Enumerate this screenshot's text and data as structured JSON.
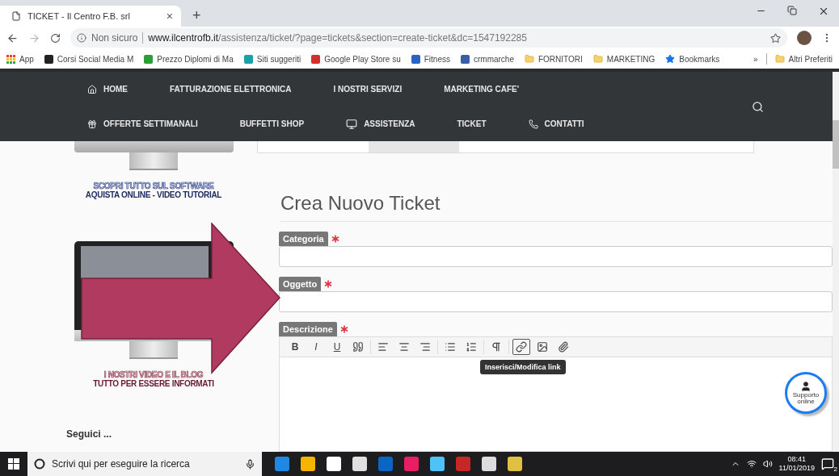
{
  "browser": {
    "tab": {
      "title": "TICKET - Il Centro F.B. srl",
      "close": "×"
    },
    "new_tab": "+",
    "address": {
      "security": "Non sicuro",
      "domain": "www.ilcentrofb.it",
      "path": "/assistenza/ticket/?page=tickets&section=create-ticket&dc=1547192285"
    },
    "bookmarks": [
      {
        "label": "App",
        "kind": "apps"
      },
      {
        "label": "Corsi Social Media M",
        "kind": "favicon",
        "color": "#222222"
      },
      {
        "label": "Prezzo Diplomi di Ma",
        "kind": "favicon",
        "color": "#2e9c3a"
      },
      {
        "label": "Siti suggeriti",
        "kind": "favicon",
        "color": "#1ba0a8"
      },
      {
        "label": "Google Play Store su",
        "kind": "favicon",
        "color": "#d32f2f"
      },
      {
        "label": "Fitness",
        "kind": "favicon",
        "color": "#2b63c5"
      },
      {
        "label": "crmmarche",
        "kind": "favicon",
        "color": "#3b5ea8"
      },
      {
        "label": "FORNITORI",
        "kind": "folder"
      },
      {
        "label": "MARKETING",
        "kind": "folder"
      },
      {
        "label": "Bookmarks",
        "kind": "star"
      }
    ],
    "overflow": "»",
    "other_bookmarks": "Altri Preferiti"
  },
  "nav": {
    "rows": [
      [
        {
          "label": "HOME",
          "kind": "home"
        },
        {
          "label": "FATTURAZIONE ELETTRONICA",
          "kind": "plain"
        },
        {
          "label": "I NOSTRI SERVIZI",
          "kind": "plain"
        },
        {
          "label": "MARKETING CAFE'",
          "kind": "plain"
        }
      ],
      [
        {
          "label": "OFFERTE SETTIMANALI",
          "kind": "gift"
        },
        {
          "label": "BUFFETTI SHOP",
          "kind": "plain"
        },
        {
          "label": "ASSISTENZA",
          "kind": "monitor"
        },
        {
          "label": "TICKET",
          "kind": "plain"
        },
        {
          "label": "CONTATTI",
          "kind": "phone"
        }
      ]
    ]
  },
  "sidebar": {
    "captions": [
      {
        "line1": "SCOPRI TUTTO SUL SOFTWARE",
        "line2": "AQUISTA ONLINE - VIDEO TUTORIAL",
        "kind": "software"
      },
      {
        "line1": "I NOSTRI VIDEO E IL BLOG",
        "line2": "TUTTO PER ESSERE INFORMATI",
        "kind": "blog"
      }
    ],
    "follow": "Seguici ..."
  },
  "form": {
    "title": "Crea Nuovo Ticket",
    "fields": [
      {
        "label": "Categoria",
        "required": true,
        "kind": "input"
      },
      {
        "label": "Oggetto",
        "required": true,
        "kind": "input"
      },
      {
        "label": "Descrizione",
        "required": true,
        "kind": "editor"
      }
    ],
    "toolbar": [
      {
        "kind": "bold",
        "label": "B",
        "selected": false
      },
      {
        "kind": "italic",
        "label": "I",
        "selected": false
      },
      {
        "kind": "underline",
        "label": "U",
        "selected": false
      },
      {
        "kind": "quote",
        "selected": false
      },
      {
        "kind": "align-left",
        "selected": false
      },
      {
        "kind": "align-center",
        "selected": false
      },
      {
        "kind": "align-right",
        "selected": false
      },
      {
        "kind": "bullets",
        "selected": false
      },
      {
        "kind": "numbers",
        "selected": false
      },
      {
        "kind": "paragraph",
        "selected": false
      },
      {
        "kind": "link",
        "selected": true,
        "tooltip": "Inserisci/Modifica link"
      },
      {
        "kind": "image",
        "selected": false
      },
      {
        "kind": "attach",
        "selected": false
      }
    ],
    "support": {
      "line1": "Supporto",
      "line2": "online"
    }
  },
  "taskbar": {
    "search": "Scrivi qui per eseguire la ricerca",
    "time": "08:41",
    "date": "11/01/2019",
    "notifications": "2"
  }
}
